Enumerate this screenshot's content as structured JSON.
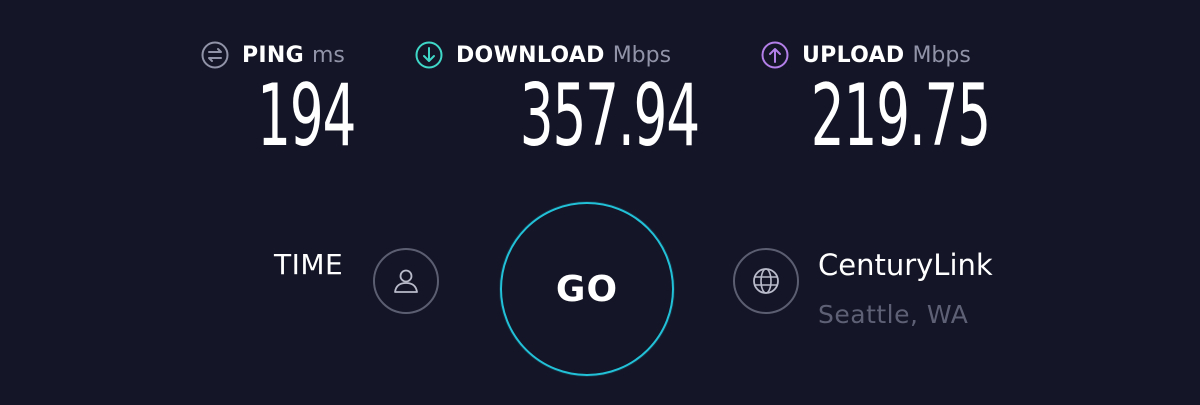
{
  "metrics": {
    "ping": {
      "icon": "ping-icon",
      "label": "PING",
      "unit": "ms",
      "value": "194",
      "color": "#9193a8"
    },
    "download": {
      "icon": "download-arrow-icon",
      "label": "DOWNLOAD",
      "unit": "Mbps",
      "value": "357.94",
      "color": "#3fd8c8"
    },
    "upload": {
      "icon": "upload-arrow-icon",
      "label": "UPLOAD",
      "unit": "Mbps",
      "value": "219.75",
      "color": "#b37fe8"
    }
  },
  "left_panel": {
    "label": "TIME",
    "icon": "user-icon"
  },
  "go_button": {
    "label": "GO",
    "color": "#22c1d8"
  },
  "server": {
    "icon": "globe-icon",
    "isp": "CenturyLink",
    "location": "Seattle, WA"
  }
}
